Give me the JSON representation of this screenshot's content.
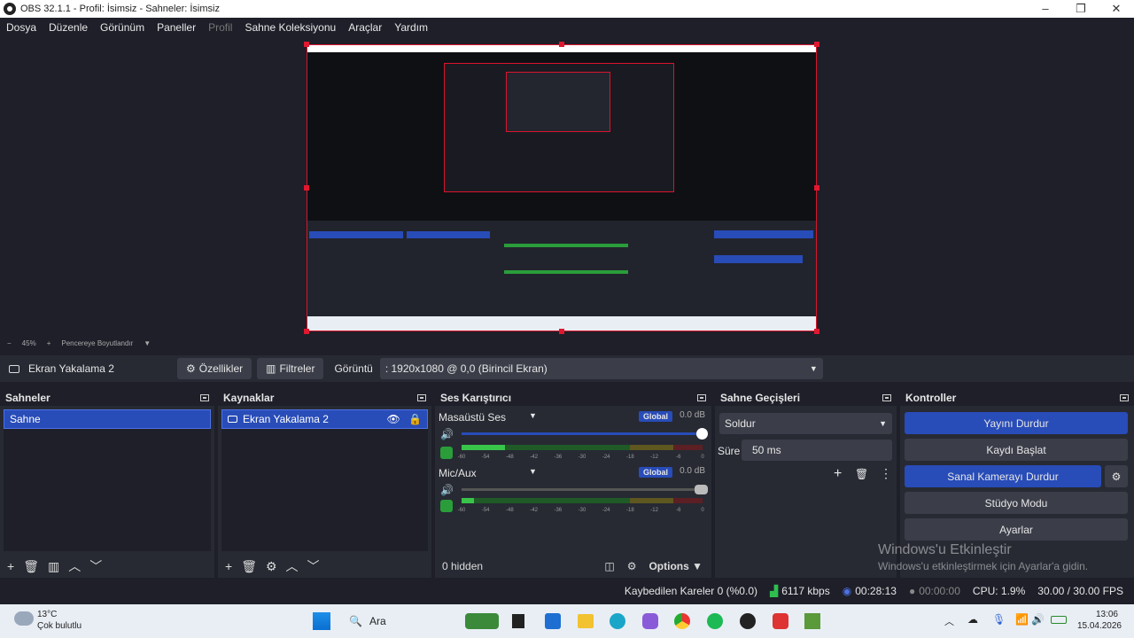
{
  "window": {
    "title": "OBS 32.1.1 - Profil: İsimsiz - Sahneler: İsimsiz"
  },
  "menu": [
    "Dosya",
    "Düzenle",
    "Görünüm",
    "Paneller",
    "Profil",
    "Sahne Koleksiyonu",
    "Araçlar",
    "Yardım"
  ],
  "zoom": {
    "minus": "−",
    "percent": "45%",
    "plus": "+",
    "fit_label": "Pencereye Boyutlandır"
  },
  "source_toolbar": {
    "source_name": "Ekran Yakalama 2",
    "properties_label": "Özellikler",
    "filters_label": "Filtreler",
    "display_label": "Görüntü",
    "display_value": ": 1920x1080 @ 0,0 (Birincil Ekran)"
  },
  "scenes": {
    "title": "Sahneler",
    "items": [
      "Sahne"
    ]
  },
  "sources": {
    "title": "Kaynaklar",
    "items": [
      "Ekran Yakalama 2"
    ]
  },
  "mixer": {
    "title": "Ses Karıştırıcı",
    "channels": [
      {
        "name": "Masaüstü Ses",
        "badge": "Global",
        "db": "0.0 dB",
        "volume": 1.0,
        "level": 0.18
      },
      {
        "name": "Mic/Aux",
        "badge": "Global",
        "db": "0.0 dB",
        "volume": 1.0,
        "level": 0.05
      }
    ],
    "ticks": [
      "-60",
      "-54",
      "-48",
      "-42",
      "-36",
      "-30",
      "-24",
      "-18",
      "-12",
      "-6",
      "0"
    ],
    "hidden_label": "0 hidden",
    "options_label": "Options"
  },
  "transitions": {
    "title": "Sahne Geçişleri",
    "transition": "Soldur",
    "duration_label": "Süre",
    "duration_value": "50 ms"
  },
  "controls": {
    "title": "Kontroller",
    "stop_stream": "Yayını Durdur",
    "start_record": "Kaydı Başlat",
    "stop_virtualcam": "Sanal Kamerayı Durdur",
    "studio_mode": "Stüdyo Modu",
    "settings": "Ayarlar"
  },
  "activation": {
    "title": "Windows'u Etkinleştir",
    "subtitle": "Windows'u etkinleştirmek için Ayarlar'a gidin."
  },
  "status": {
    "dropped": "Kaybedilen Kareler 0 (%0.0)",
    "bitrate": "6117 kbps",
    "stream_time": "00:28:13",
    "record_time": "00:00:00",
    "cpu": "CPU: 1.9%",
    "fps": "30.00 / 30.00 FPS"
  },
  "taskbar": {
    "weather_temp": "13°C",
    "weather_desc": "Çok bulutlu",
    "search": "Ara",
    "time": "13:06",
    "date": "15.04.2026"
  },
  "colors": {
    "accent": "#284cb8",
    "panel": "#272a33",
    "bg": "#1e1f29",
    "red_border": "#d9142d"
  }
}
